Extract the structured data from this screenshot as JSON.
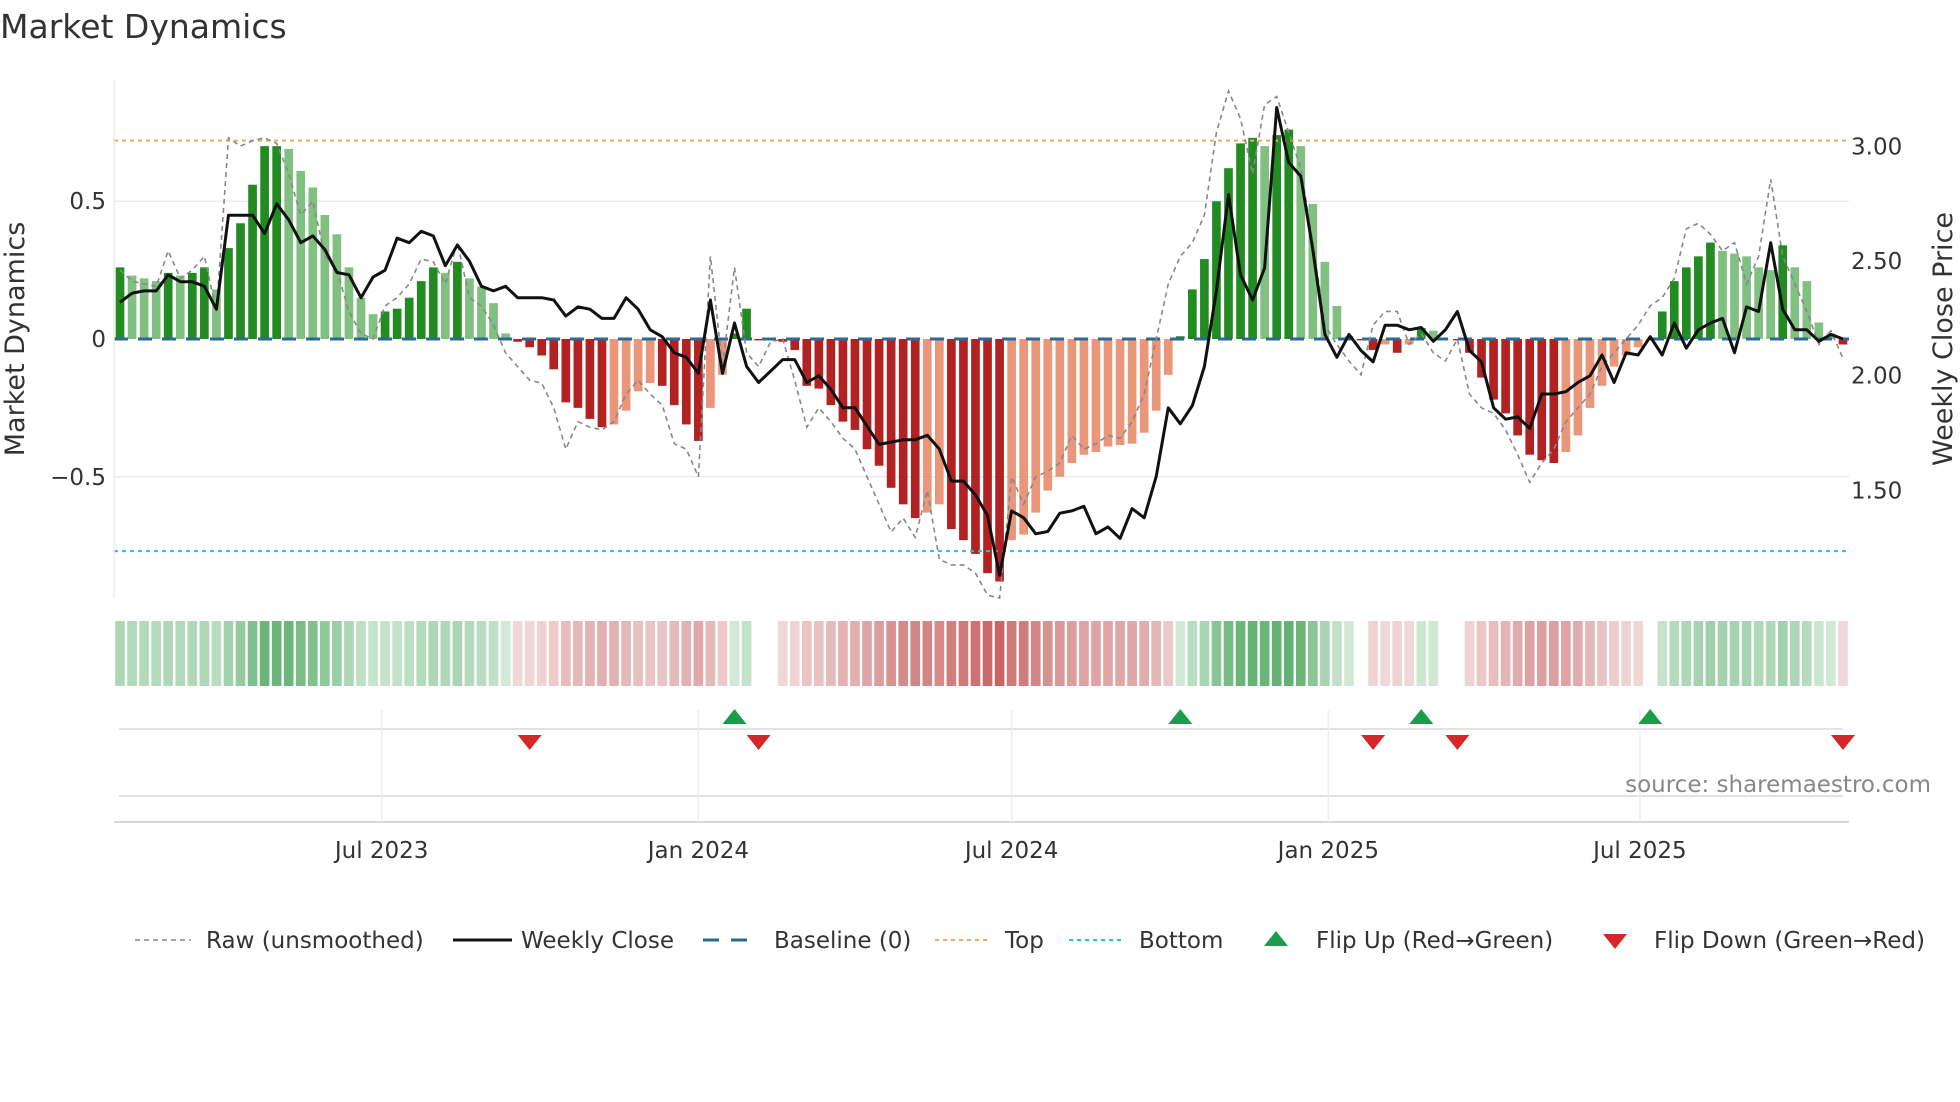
{
  "title": "Market Dynamics",
  "source": "source: sharemaestro.com",
  "colors": {
    "pos_up": "#228b22",
    "pos_down": "#80c080",
    "neg_down": "#b22222",
    "neg_up": "#e9967a",
    "baseline": "#2b6a94",
    "top": "#f0a868",
    "bottom": "#22c4d8",
    "flip_up": "#1a9e4a",
    "flip_down": "#d62728",
    "price": "#111111",
    "raw": "#888888"
  },
  "chart_data": {
    "type": "bar",
    "title": "Market Dynamics",
    "ylabel": "Market Dynamics",
    "y2label": "Weekly Close Price",
    "start_week": "2023-01-30",
    "frequency": "weekly",
    "ylim": [
      -0.94,
      0.94
    ],
    "y2lim": [
      1.03,
      3.29
    ],
    "yticks": [
      {
        "v": 0.5,
        "label": "0.5"
      },
      {
        "v": 0,
        "label": "0"
      },
      {
        "v": -0.5,
        "label": "−0.5"
      }
    ],
    "y2ticks": [
      {
        "v": 3.0,
        "label": "3.00"
      },
      {
        "v": 2.5,
        "label": "2.50"
      },
      {
        "v": 2.0,
        "label": "2.00"
      },
      {
        "v": 1.5,
        "label": "1.50"
      }
    ],
    "xticks": [
      {
        "date": "2023-07-01",
        "label": "Jul 2023"
      },
      {
        "date": "2024-01-01",
        "label": "Jan 2024"
      },
      {
        "date": "2024-07-01",
        "label": "Jul 2024"
      },
      {
        "date": "2025-01-01",
        "label": "Jan 2025"
      },
      {
        "date": "2025-07-01",
        "label": "Jul 2025"
      }
    ],
    "top_level": 0.72,
    "bottom_level": -0.77,
    "baseline": 0,
    "momentum": [
      0.26,
      0.23,
      0.22,
      0.21,
      0.24,
      0.23,
      0.24,
      0.26,
      0.18,
      0.33,
      0.42,
      0.56,
      0.7,
      0.7,
      0.69,
      0.61,
      0.55,
      0.45,
      0.38,
      0.26,
      0.15,
      0.09,
      0.1,
      0.11,
      0.15,
      0.21,
      0.26,
      0.24,
      0.28,
      0.22,
      0.19,
      0.13,
      0.02,
      -0.01,
      -0.03,
      -0.06,
      -0.11,
      -0.23,
      -0.25,
      -0.29,
      -0.32,
      -0.31,
      -0.26,
      -0.19,
      -0.16,
      -0.17,
      -0.24,
      -0.31,
      -0.37,
      -0.25,
      -0.13,
      0.02,
      0.11,
      -0.005,
      0.0,
      -0.01,
      -0.04,
      -0.17,
      -0.18,
      -0.24,
      -0.3,
      -0.33,
      -0.4,
      -0.46,
      -0.54,
      -0.6,
      -0.65,
      -0.63,
      -0.6,
      -0.69,
      -0.73,
      -0.78,
      -0.85,
      -0.88,
      -0.73,
      -0.71,
      -0.63,
      -0.55,
      -0.5,
      -0.45,
      -0.42,
      -0.41,
      -0.39,
      -0.385,
      -0.38,
      -0.34,
      -0.26,
      -0.13,
      0.01,
      0.18,
      0.29,
      0.5,
      0.62,
      0.71,
      0.73,
      0.7,
      0.74,
      0.76,
      0.7,
      0.49,
      0.28,
      0.12,
      0.01,
      -0.005,
      -0.04,
      -0.02,
      -0.05,
      -0.02,
      0.04,
      0.03,
      0.0,
      -0.005,
      -0.05,
      -0.14,
      -0.22,
      -0.27,
      -0.35,
      -0.42,
      -0.44,
      -0.45,
      -0.41,
      -0.35,
      -0.25,
      -0.17,
      -0.1,
      -0.06,
      -0.03,
      -0.005,
      0.1,
      0.21,
      0.26,
      0.3,
      0.35,
      0.32,
      0.31,
      0.3,
      0.26,
      0.25,
      0.34,
      0.26,
      0.21,
      0.06,
      0.02,
      -0.02
    ],
    "raw": [
      0.25,
      0.21,
      0.2,
      0.19,
      0.32,
      0.22,
      0.25,
      0.3,
      0.1,
      0.73,
      0.7,
      0.72,
      0.73,
      0.71,
      0.6,
      0.45,
      0.5,
      0.3,
      0.25,
      0.1,
      0.02,
      0.0,
      0.12,
      0.15,
      0.2,
      0.29,
      0.28,
      0.2,
      0.35,
      0.15,
      0.12,
      0.05,
      -0.05,
      -0.1,
      -0.15,
      -0.16,
      -0.25,
      -0.4,
      -0.3,
      -0.32,
      -0.33,
      -0.3,
      -0.2,
      -0.15,
      -0.2,
      -0.24,
      -0.38,
      -0.4,
      -0.5,
      0.3,
      -0.1,
      0.26,
      -0.05,
      -0.1,
      -0.01,
      0.0,
      -0.15,
      -0.32,
      -0.25,
      -0.3,
      -0.36,
      -0.4,
      -0.5,
      -0.6,
      -0.7,
      -0.65,
      -0.72,
      -0.55,
      -0.8,
      -0.82,
      -0.82,
      -0.85,
      -0.93,
      -0.94,
      -0.5,
      -0.6,
      -0.5,
      -0.48,
      -0.45,
      -0.35,
      -0.4,
      -0.38,
      -0.35,
      -0.36,
      -0.3,
      -0.2,
      0.0,
      0.2,
      0.3,
      0.35,
      0.45,
      0.75,
      0.9,
      0.8,
      0.6,
      0.85,
      0.88,
      0.75,
      0.62,
      0.35,
      0.05,
      -0.02,
      -0.08,
      -0.13,
      0.05,
      0.1,
      0.1,
      -0.02,
      0.02,
      -0.05,
      -0.08,
      0.0,
      -0.2,
      -0.25,
      -0.27,
      -0.33,
      -0.42,
      -0.52,
      -0.45,
      -0.4,
      -0.3,
      -0.25,
      -0.2,
      -0.1,
      -0.05,
      0.0,
      0.05,
      0.12,
      0.15,
      0.22,
      0.4,
      0.42,
      0.38,
      0.32,
      0.35,
      0.2,
      0.3,
      0.58,
      0.3,
      0.2,
      0.1,
      -0.02,
      0.03,
      -0.07
    ],
    "price": [
      2.32,
      2.36,
      2.37,
      2.37,
      2.44,
      2.41,
      2.41,
      2.39,
      2.29,
      2.7,
      2.7,
      2.7,
      2.62,
      2.75,
      2.68,
      2.58,
      2.61,
      2.55,
      2.45,
      2.44,
      2.34,
      2.43,
      2.46,
      2.6,
      2.58,
      2.63,
      2.61,
      2.48,
      2.57,
      2.5,
      2.39,
      2.37,
      2.39,
      2.34,
      2.34,
      2.34,
      2.33,
      2.26,
      2.3,
      2.29,
      2.25,
      2.25,
      2.34,
      2.29,
      2.2,
      2.17,
      2.1,
      2.08,
      2.01,
      2.33,
      2.01,
      2.23,
      2.04,
      1.97,
      2.02,
      2.07,
      2.07,
      1.97,
      2.0,
      1.94,
      1.86,
      1.86,
      1.78,
      1.7,
      1.71,
      1.72,
      1.72,
      1.74,
      1.68,
      1.54,
      1.54,
      1.48,
      1.39,
      1.13,
      1.41,
      1.38,
      1.31,
      1.32,
      1.4,
      1.41,
      1.43,
      1.31,
      1.34,
      1.29,
      1.42,
      1.38,
      1.56,
      1.86,
      1.79,
      1.87,
      2.04,
      2.37,
      2.79,
      2.44,
      2.33,
      2.47,
      3.17,
      2.93,
      2.87,
      2.55,
      2.18,
      2.08,
      2.18,
      2.11,
      2.06,
      2.22,
      2.22,
      2.2,
      2.21,
      2.15,
      2.2,
      2.28,
      2.11,
      2.06,
      1.86,
      1.81,
      1.82,
      1.77,
      1.92,
      1.92,
      1.93,
      1.97,
      2.0,
      2.09,
      1.97,
      2.1,
      2.09,
      2.17,
      2.09,
      2.23,
      2.12,
      2.2,
      2.23,
      2.25,
      2.1,
      2.3,
      2.28,
      2.58,
      2.29,
      2.2,
      2.2,
      2.15,
      2.18,
      2.16
    ],
    "flip_up_weeks": [
      51,
      88,
      108,
      127
    ],
    "flip_down_weeks": [
      34,
      53,
      104,
      111,
      143
    ],
    "legend": {
      "position": "bottom",
      "items": [
        {
          "label": "Raw (unsmoothed)",
          "kind": "raw"
        },
        {
          "label": "Weekly Close",
          "kind": "price"
        },
        {
          "label": "Baseline (0)",
          "kind": "baseline"
        },
        {
          "label": "Top",
          "kind": "top"
        },
        {
          "label": "Bottom",
          "kind": "bottom"
        },
        {
          "label": "Flip Up (Red→Green)",
          "kind": "flip_up"
        },
        {
          "label": "Flip Down (Green→Red)",
          "kind": "flip_down"
        }
      ]
    }
  }
}
